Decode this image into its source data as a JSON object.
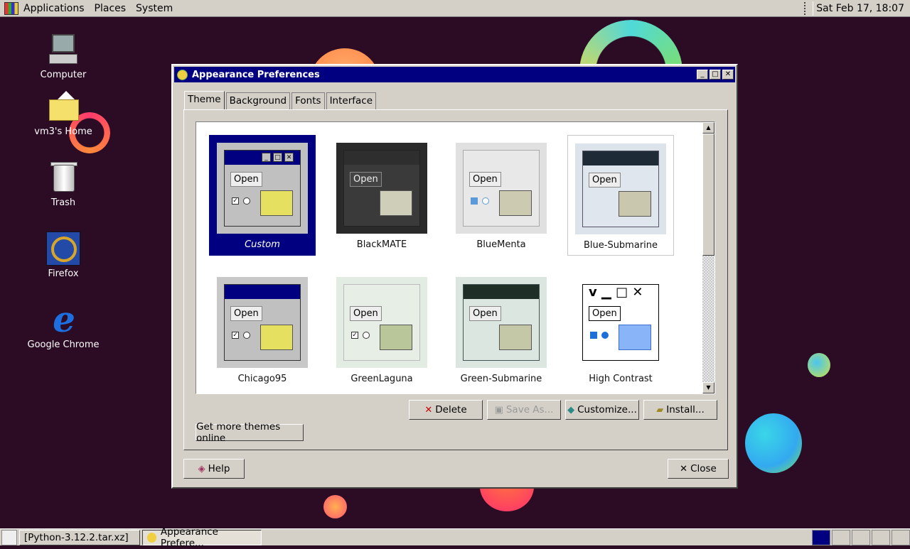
{
  "top_panel": {
    "menus": [
      "Applications",
      "Places",
      "System"
    ],
    "clock": "Sat Feb 17, 18:07"
  },
  "desktop": {
    "icons": [
      {
        "label": "Computer",
        "icon": "computer-icon"
      },
      {
        "label": "vm3's Home",
        "icon": "home-folder-icon"
      },
      {
        "label": "Trash",
        "icon": "trash-icon"
      },
      {
        "label": "Firefox",
        "icon": "firefox-icon"
      },
      {
        "label": "Google Chrome",
        "icon": "chrome-icon"
      }
    ]
  },
  "window": {
    "title": "Appearance Preferences",
    "tabs": [
      "Theme",
      "Background",
      "Fonts",
      "Interface"
    ],
    "active_tab": "Theme",
    "themes": [
      {
        "name": "Custom",
        "selected": true
      },
      {
        "name": "BlackMATE"
      },
      {
        "name": "BlueMenta"
      },
      {
        "name": "Blue-Submarine",
        "hovered": true
      },
      {
        "name": "Chicago95"
      },
      {
        "name": "GreenLaguna"
      },
      {
        "name": "Green-Submarine"
      },
      {
        "name": "High Contrast"
      }
    ],
    "preview_open_label": "Open",
    "buttons": {
      "delete": "Delete",
      "save_as": "Save As...",
      "customize": "Customize...",
      "install": "Install...",
      "more_themes": "Get more themes online",
      "help": "Help",
      "close": "Close"
    }
  },
  "taskbar": {
    "tasks": [
      {
        "label": "[Python-3.12.2.tar.xz]",
        "active": false
      },
      {
        "label": "Appearance Prefere...",
        "active": true
      }
    ]
  },
  "colors": {
    "title_bar": "#000080",
    "face": "#d4d0c8",
    "desktop": "#2c0c24"
  }
}
